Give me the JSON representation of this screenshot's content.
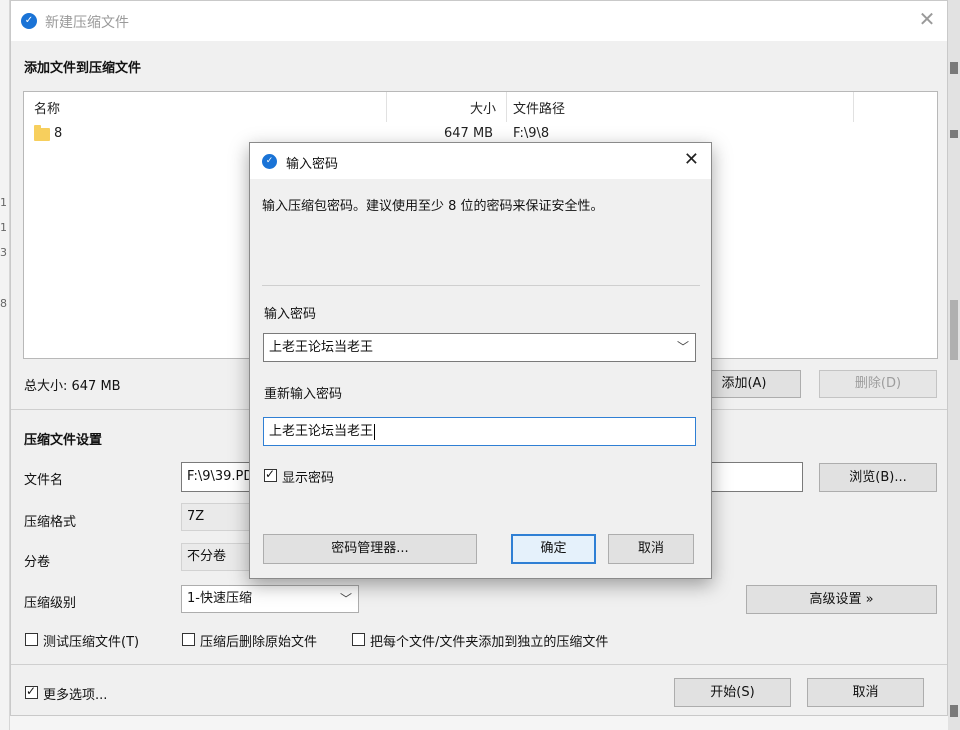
{
  "background": {
    "left_digits": [
      "1",
      "1",
      "3",
      "8"
    ]
  },
  "window": {
    "title": "新建压缩文件",
    "close_glyph": "✕"
  },
  "files_section": {
    "title": "添加文件到压缩文件",
    "columns": {
      "name": "名称",
      "size": "大小",
      "path": "文件路径"
    },
    "rows": [
      {
        "name": "8",
        "size": "647 MB",
        "path": "F:\\9\\8",
        "icon": "folder-icon"
      }
    ],
    "total_size": "总大小: 647 MB",
    "add_button": "添加(A)",
    "delete_button": "删除(D)"
  },
  "settings": {
    "title": "压缩文件设置",
    "filename_label": "文件名",
    "filename_value": "F:\\9\\39.PD",
    "browse_button": "浏览(B)...",
    "format_label": "压缩格式",
    "format_value": "7Z",
    "split_label": "分卷",
    "split_value": "不分卷",
    "level_label": "压缩级别",
    "level_value": "1-快速压缩",
    "advanced_button": "高级设置 »",
    "test_checkbox": "测试压缩文件(T)",
    "delete_after_checkbox": "压缩后删除原始文件",
    "separate_checkbox": "把每个文件/文件夹添加到独立的压缩文件"
  },
  "footer": {
    "more_options": "更多选项...",
    "start_button": "开始(S)",
    "cancel_button": "取消"
  },
  "password_dialog": {
    "title": "输入密码",
    "close_glyph": "✕",
    "description": "输入压缩包密码。建议使用至少 8 位的密码来保证安全性。",
    "password_label": "输入密码",
    "password_value": "上老王论坛当老王",
    "confirm_label": "重新输入密码",
    "confirm_value": "上老王论坛当老王",
    "show_password": "显示密码",
    "manager_button": "密码管理器...",
    "ok_button": "确定",
    "cancel_button": "取消"
  },
  "colors": {
    "accent": "#1a73d6",
    "focus_border": "#2f7fd4"
  }
}
